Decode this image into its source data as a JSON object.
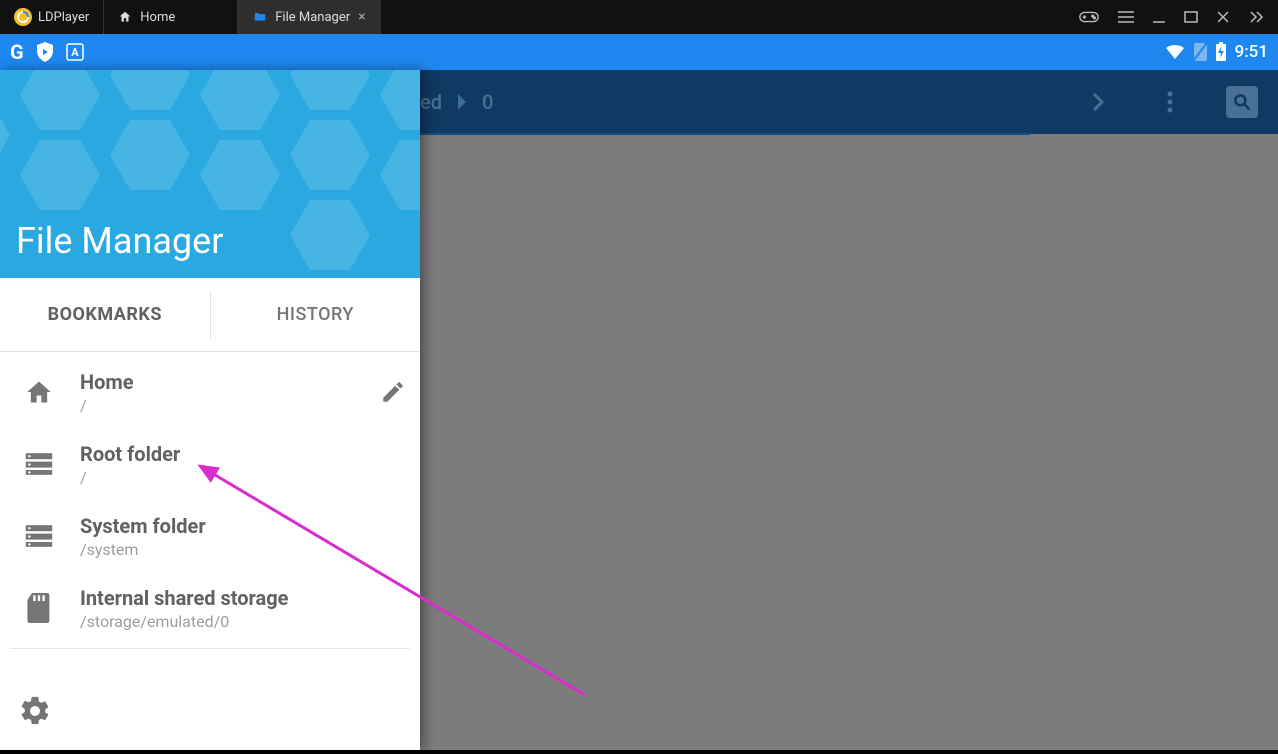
{
  "chrome": {
    "brand": "LDPlayer",
    "tabs": [
      {
        "label": "Home",
        "active": false
      },
      {
        "label": "File Manager",
        "active": true
      }
    ]
  },
  "statusbar": {
    "time": "9:51"
  },
  "actionbar": {
    "path_part": "ed",
    "count": "0"
  },
  "drawer": {
    "title": "File Manager",
    "tabs": {
      "bookmarks": "BOOKMARKS",
      "history": "HISTORY"
    },
    "items": [
      {
        "title": "Home",
        "path": "/",
        "icon": "home",
        "editable": true
      },
      {
        "title": "Root folder",
        "path": "/",
        "icon": "storage",
        "editable": false
      },
      {
        "title": "System folder",
        "path": "/system",
        "icon": "storage",
        "editable": false
      },
      {
        "title": "Internal shared storage",
        "path": "/storage/emulated/0",
        "icon": "sdcard",
        "editable": false
      }
    ]
  }
}
